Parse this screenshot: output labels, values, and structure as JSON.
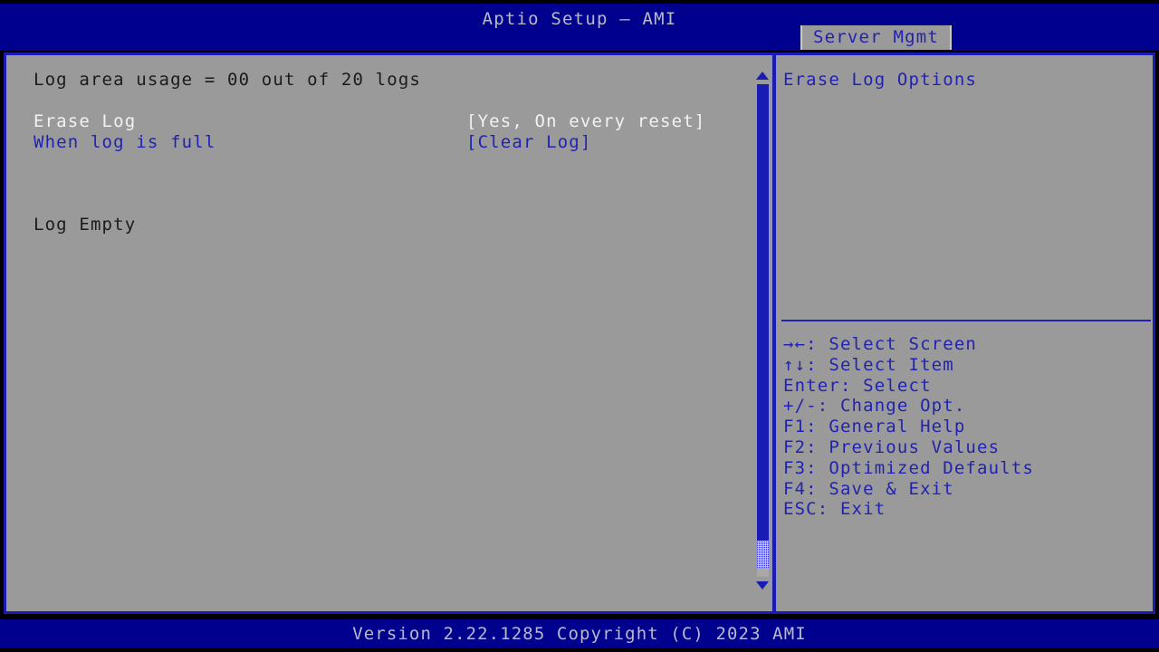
{
  "colors": {
    "bar_blue": "#00008f",
    "accent_blue": "#2222b0",
    "border_blue": "#1a1ab4",
    "panel_gray": "#9a9a9a",
    "selected_white": "#f2f2f2",
    "text_dark": "#1b1b1b",
    "screen_black": "#000000"
  },
  "titlebar": {
    "title": "Aptio Setup – AMI"
  },
  "tabs": [
    {
      "label": "Server Mgmt",
      "active": true
    }
  ],
  "main": {
    "status_line": "Log area usage = 00 out of 20 logs",
    "rows": [
      {
        "label": "Erase Log",
        "value": "[Yes, On every reset]",
        "state": "selected"
      },
      {
        "label": "When log is full",
        "value": "[Clear Log]",
        "state": "normal"
      }
    ],
    "log_status": "Log Empty",
    "scrollbar": {
      "up_arrow": "scroll-up-arrow",
      "down_arrow": "scroll-down-arrow"
    }
  },
  "help": {
    "title": "Erase Log Options",
    "keys": [
      "→←: Select Screen",
      "↑↓: Select Item",
      "Enter: Select",
      "+/-: Change Opt.",
      "F1: General Help",
      "F2: Previous Values",
      "F3: Optimized Defaults",
      "F4: Save & Exit",
      "ESC: Exit"
    ]
  },
  "footer": {
    "version": "Version 2.22.1285 Copyright (C) 2023 AMI"
  }
}
